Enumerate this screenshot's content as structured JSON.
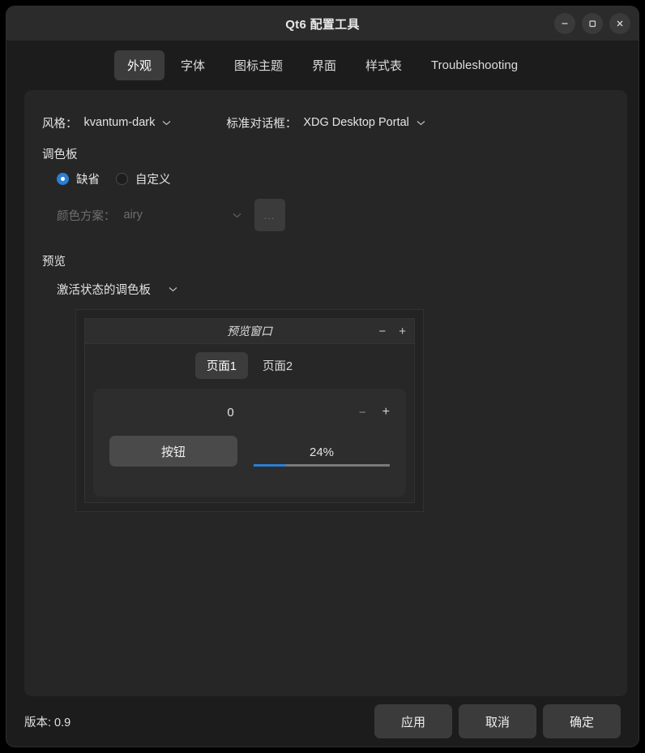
{
  "window": {
    "title": "Qt6 配置工具",
    "controls": [
      {
        "name": "minimize",
        "glyph": "−"
      },
      {
        "name": "maximize",
        "glyph": "□"
      },
      {
        "name": "close",
        "glyph": "✕"
      }
    ]
  },
  "tabs": [
    {
      "label": "外观",
      "selected": true
    },
    {
      "label": "字体",
      "selected": false
    },
    {
      "label": "图标主题",
      "selected": false
    },
    {
      "label": "界面",
      "selected": false
    },
    {
      "label": "样式表",
      "selected": false
    },
    {
      "label": "Troubleshooting",
      "selected": false
    }
  ],
  "appearance": {
    "style": {
      "label": "风格：",
      "value": "kvantum-dark"
    },
    "dialog": {
      "label": "标准对话框：",
      "value": "XDG Desktop Portal"
    },
    "palette": {
      "section_label": "调色板",
      "radio_default": "缺省",
      "radio_custom": "自定义",
      "selected": "缺省"
    },
    "color_scheme": {
      "label": "颜色方案：",
      "value": "airy",
      "browse_label": "...",
      "disabled": true
    },
    "preview": {
      "section_label": "预览",
      "palette_state": "激活状态的调色板",
      "window": {
        "title": "预览窗口",
        "minimize_glyph": "−",
        "maximize_glyph": "+",
        "tabs": [
          {
            "label": "页面1",
            "selected": true
          },
          {
            "label": "页面2",
            "selected": false
          }
        ],
        "spinbox_value": "0",
        "spin_down_glyph": "−",
        "spin_up_glyph": "+",
        "button_label": "按钮",
        "progress_text": "24%",
        "progress_percent": 24
      }
    }
  },
  "footer": {
    "version": "版本: 0.9",
    "apply_label": "应用",
    "cancel_label": "取消",
    "ok_label": "确定"
  },
  "colors": {
    "accent": "#2b7fd4",
    "window_bg": "#1c1c1c",
    "panel_bg": "#262626",
    "titlebar_bg": "#2b2b2b",
    "button_bg": "#3b3b3b",
    "text": "#e4e4e4",
    "text_disabled": "#6e6e6e"
  }
}
